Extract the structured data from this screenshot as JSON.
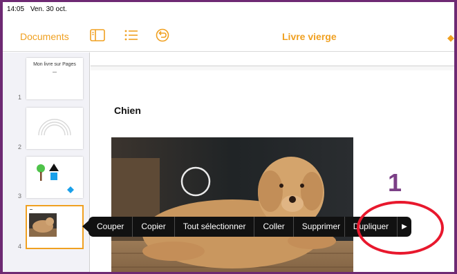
{
  "status": {
    "time": "14:05",
    "date": "Ven. 30 oct."
  },
  "toolbar": {
    "documents_label": "Documents",
    "title": "Livre vierge"
  },
  "sidebar": {
    "pages": [
      {
        "number": "1",
        "thumb_title": "Mon livre sur Pages"
      },
      {
        "number": "2"
      },
      {
        "number": "3"
      },
      {
        "number": "4"
      }
    ]
  },
  "document": {
    "title": "Chien"
  },
  "annotation": {
    "step_number": "1"
  },
  "context_menu": {
    "items": [
      "Couper",
      "Copier",
      "Tout sélectionner",
      "Coller",
      "Supprimer",
      "Dupliquer"
    ]
  },
  "colors": {
    "accent": "#f0a020",
    "frame": "#6e2a73",
    "annotation": "#e8182d",
    "step": "#7b3f86"
  },
  "icons": [
    "sidebar-icon",
    "list-icon",
    "undo-icon",
    "more-menu-arrow-icon"
  ]
}
